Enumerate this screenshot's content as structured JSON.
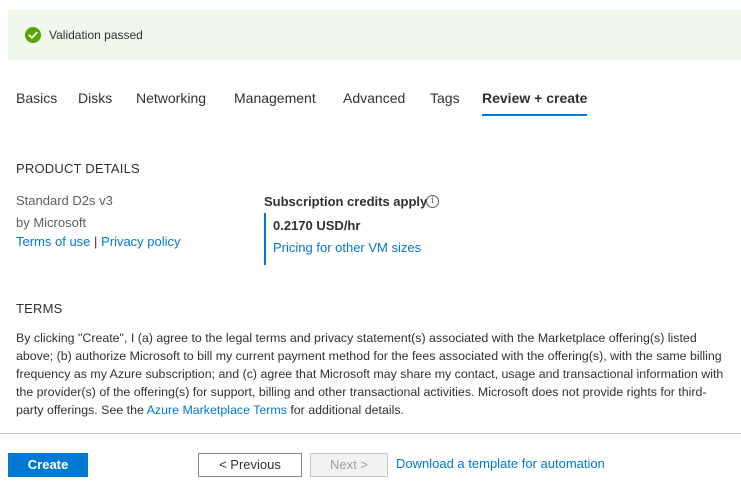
{
  "banner": {
    "text": "Validation passed",
    "icon": "check-circle-icon",
    "color": "#57a300"
  },
  "tabs": [
    {
      "label": "Basics"
    },
    {
      "label": "Disks"
    },
    {
      "label": "Networking"
    },
    {
      "label": "Management"
    },
    {
      "label": "Advanced"
    },
    {
      "label": "Tags"
    },
    {
      "label": "Review + create",
      "active": true
    }
  ],
  "product": {
    "heading": "PRODUCT DETAILS",
    "name": "Standard D2s v3",
    "by": "by Microsoft",
    "terms_link": "Terms of use",
    "separator": "|",
    "privacy_link": "Privacy policy"
  },
  "pricing": {
    "title": "Subscription credits apply",
    "info_icon": "info-icon",
    "price": "0.2170 USD/hr",
    "other_sizes_link": "Pricing for other VM sizes"
  },
  "terms": {
    "heading": "TERMS",
    "text_before": "By clicking \"Create\", I (a) agree to the legal terms and privacy statement(s) associated with the Marketplace offering(s) listed above; (b) authorize Microsoft to bill my current payment method for the fees associated with the offering(s), with the same billing frequency as my Azure subscription; and (c) agree that Microsoft may share my contact, usage and transactional information with the provider(s) of the offering(s) for support, billing and other transactional activities. Microsoft does not provide rights for third-party offerings. See the ",
    "link": "Azure Marketplace Terms",
    "text_after": " for additional details."
  },
  "footer": {
    "create": "Create",
    "previous": "< Previous",
    "next": "Next >",
    "download": "Download a template for automation"
  },
  "colors": {
    "accent": "#0078d4",
    "banner_bg": "#f1f8ec"
  }
}
